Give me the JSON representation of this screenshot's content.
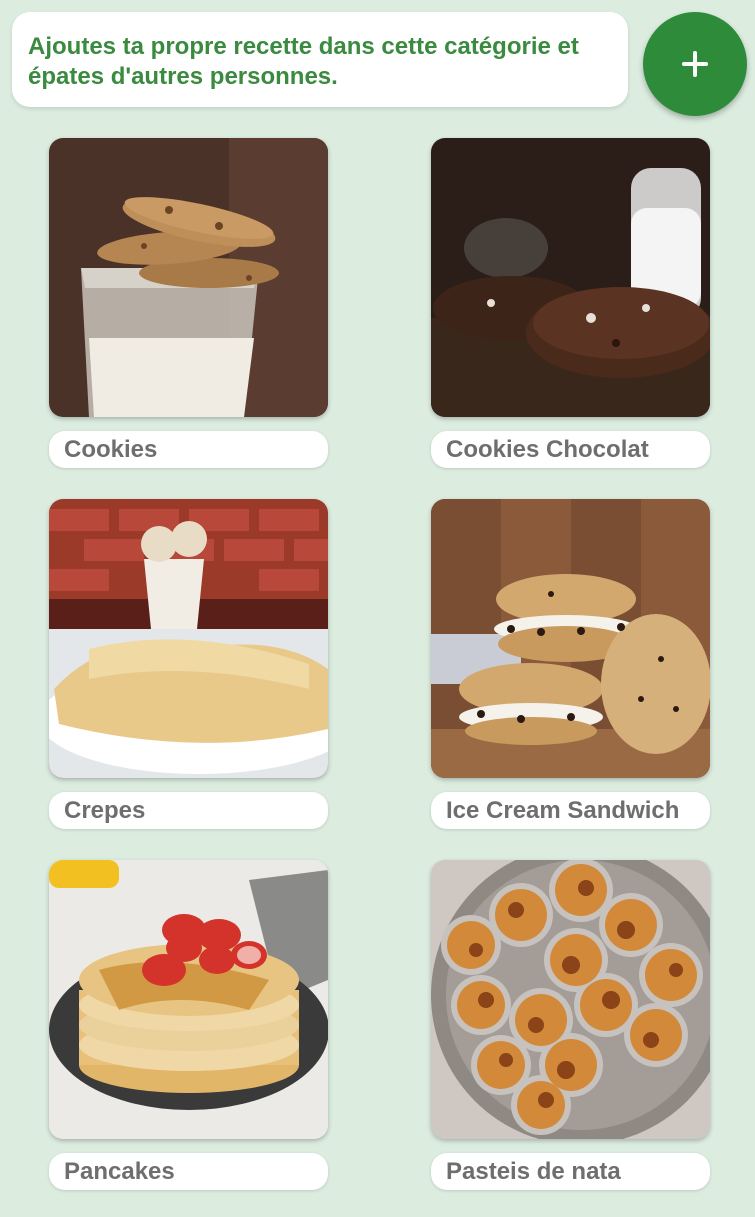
{
  "banner": {
    "text": "Ajoutes ta propre recette dans cette catégorie et épates d'autres personnes."
  },
  "add_button": {
    "icon": "plus-icon",
    "color": "#2e8b3a"
  },
  "recipes": [
    {
      "title": "Cookies"
    },
    {
      "title": "Cookies Chocolat"
    },
    {
      "title": "Crepes"
    },
    {
      "title": "Ice Cream Sandwich"
    },
    {
      "title": "Pancakes"
    },
    {
      "title": "Pasteis de nata"
    }
  ]
}
